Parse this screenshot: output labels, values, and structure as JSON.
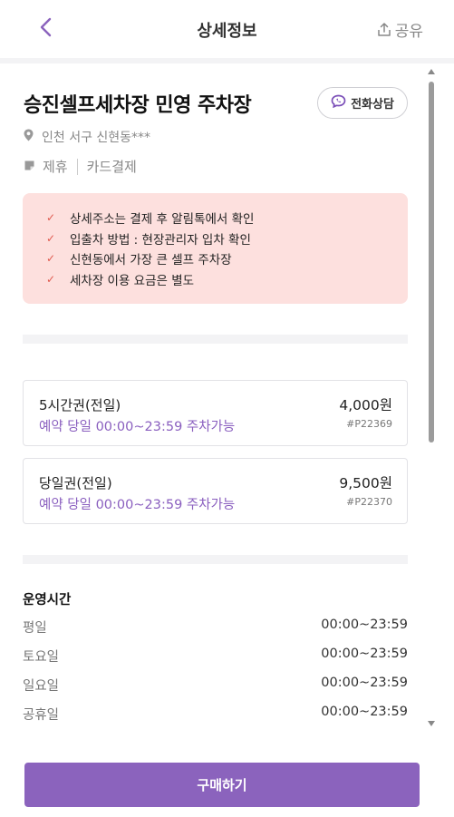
{
  "header": {
    "title": "상세정보",
    "share_label": "공유"
  },
  "lot": {
    "name": "승진셀프세차장 민영 주차장",
    "call_label": "전화상담",
    "address": "인천 서구 신현동***",
    "tags": [
      "제휴",
      "카드결제"
    ]
  },
  "notice": {
    "items": [
      "상세주소는 결제 후 알림톡에서 확인",
      "입출차 방법 : 현장관리자 입차 확인",
      "신현동에서 가장 큰 셀프 주차장",
      "세차장 이용 요금은 별도"
    ]
  },
  "tickets": [
    {
      "name": "5시간권(전일)",
      "desc": "예약 당일 00:00~23:59 주차가능",
      "price": "4,000원",
      "code": "#P22369"
    },
    {
      "name": "당일권(전일)",
      "desc": "예약 당일 00:00~23:59 주차가능",
      "price": "9,500원",
      "code": "#P22370"
    }
  ],
  "hours": {
    "title": "운영시간",
    "rows": [
      {
        "day": "평일",
        "time": "00:00~23:59"
      },
      {
        "day": "토요일",
        "time": "00:00~23:59"
      },
      {
        "day": "일요일",
        "time": "00:00~23:59"
      },
      {
        "day": "공휴일",
        "time": "00:00~23:59"
      }
    ]
  },
  "footer": {
    "buy_label": "구매하기"
  },
  "colors": {
    "accent": "#8b63bd",
    "notice_bg": "#fde0de",
    "check": "#e05a4f"
  },
  "icons": {
    "back": "chevron-left-icon",
    "share": "share-icon",
    "call": "chat-phone-icon",
    "address": "location-pin-icon",
    "tag": "tag-icon",
    "check": "check-icon"
  }
}
